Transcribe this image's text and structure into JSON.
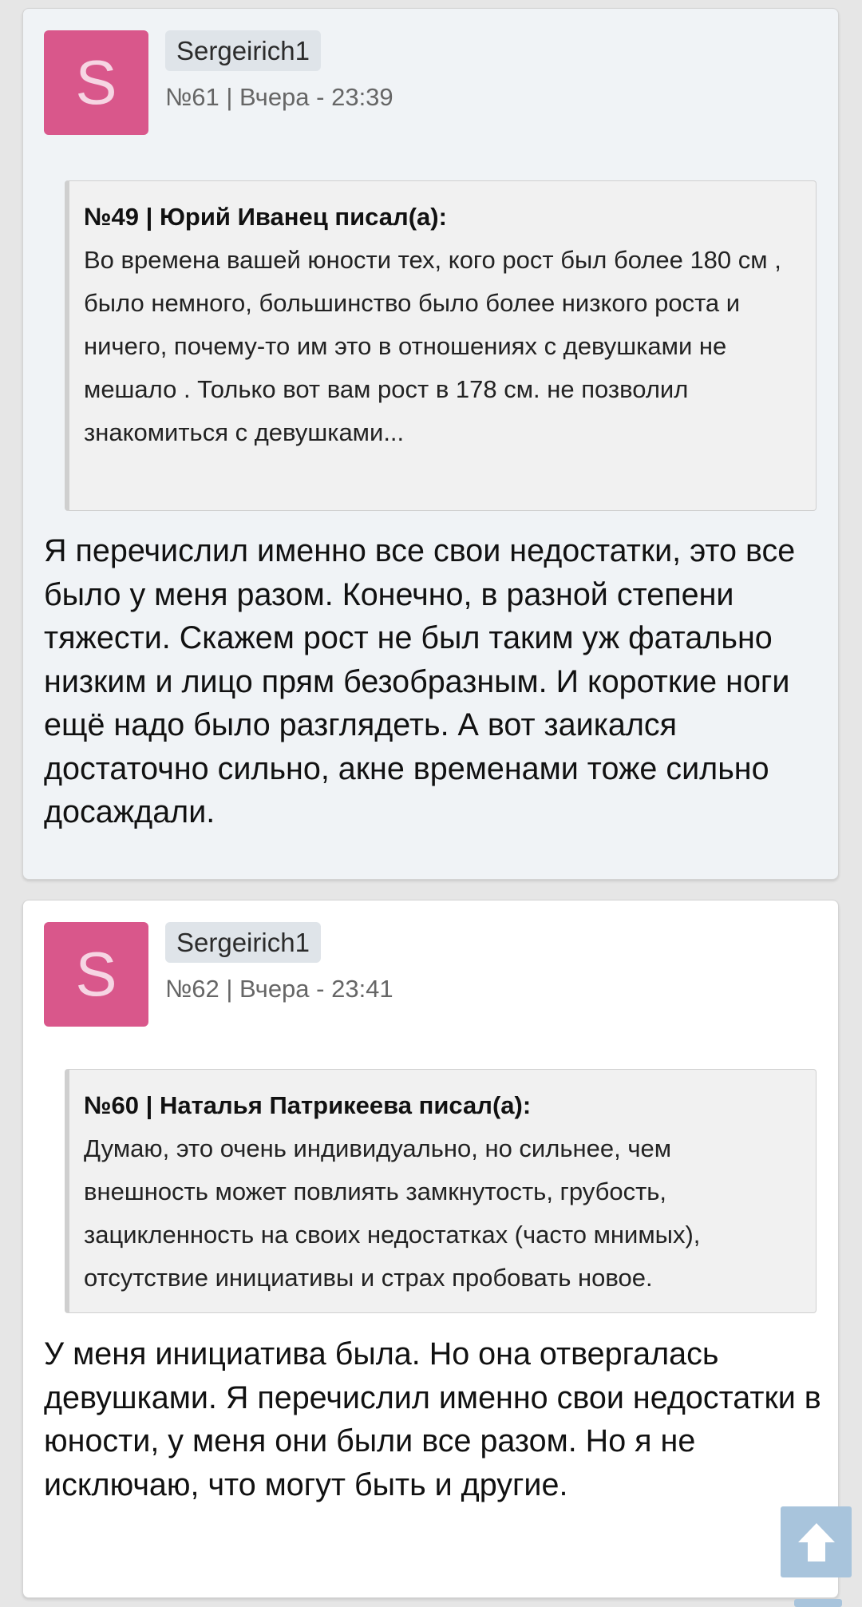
{
  "posts": [
    {
      "avatar_letter": "S",
      "username": "Sergeirich1",
      "meta": "№61 | Вчера - 23:39",
      "quote": {
        "header": "№49 | Юрий Иванец писал(а):",
        "text": "Во времена вашей юности тех, кого рост был более 180 см , было немного, большинство было более низкого роста и ничего, почему-то им это в отношениях с девушками не мешало . Только вот вам рост в 178 см. не позволил знакомиться с девушками..."
      },
      "text": "Я перечислил именно все свои недостатки, это все было у меня разом. Конечно, в разной степени тяжести. Скажем рост не был таким уж фатально низким и лицо прям безобразным. И короткие ноги ещё надо было разглядеть. А вот заикался достаточно сильно, акне временами тоже сильно досаждали."
    },
    {
      "avatar_letter": "S",
      "username": "Sergeirich1",
      "meta": "№62 | Вчера - 23:41",
      "quote": {
        "header": "№60 | Наталья Патрикеева писал(а):",
        "text": "Думаю, это очень индивидуально, но сильнее, чем внешность может повлиять замкнутость, грубость, зацикленность на своих недостатках (часто мнимых), отсутствие инициативы и страх пробовать новое."
      },
      "text": "У меня инициатива была. Но она отвергалась девушками. Я перечислил именно свои недостатки в юности, у меня они были все разом. Но я не исключаю, что могут быть и другие."
    }
  ],
  "scroll_top": {
    "icon": "arrow-up-icon"
  },
  "colors": {
    "avatar_bg": "#d9578b",
    "avatar_letter": "#f6d5e3",
    "post_bg_alt": "#f0f3f6",
    "username_bg": "#dfe4e9",
    "scroll_button": "#a8c4dc"
  }
}
